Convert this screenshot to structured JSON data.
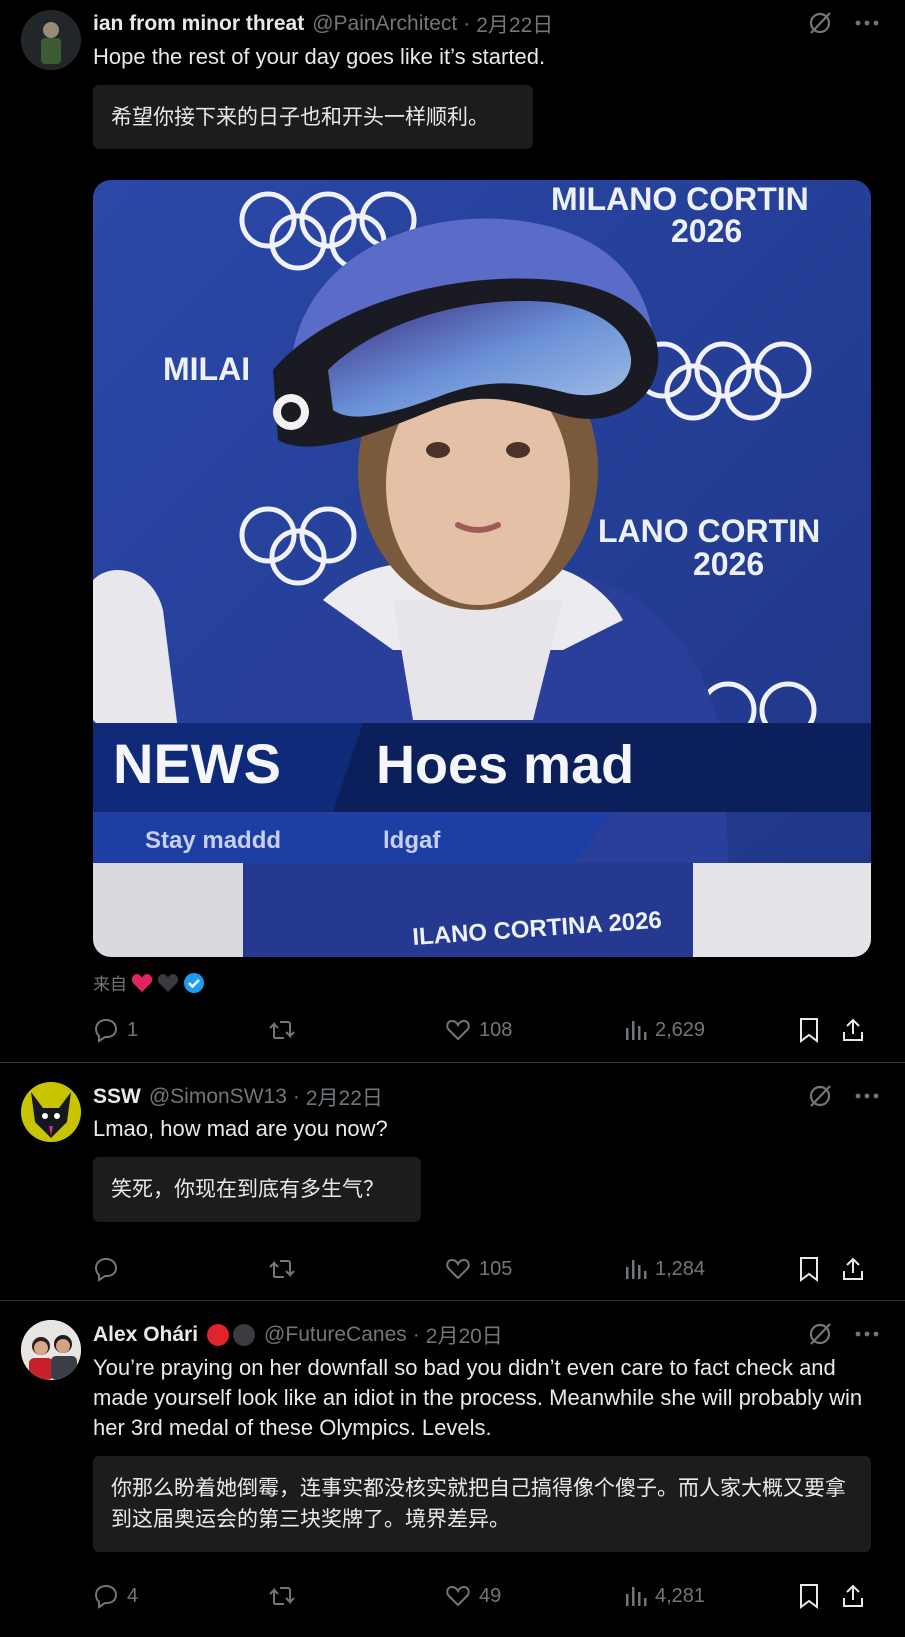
{
  "posts": [
    {
      "name": "ian from minor threat",
      "handle": "@PainArchitect",
      "date": "2月22日",
      "text": "Hope the rest of your day goes like it’s started.",
      "translation": "希望你接下来的日子也和开头一样顺利。",
      "media": {
        "logo_top": "MILANO CORTIN",
        "year_top": "2026",
        "logo_left": "MILAI",
        "logo_right": "LANO CORTIN",
        "year_right": "2026",
        "news_label": "NEWS",
        "headline": "Hoes mad",
        "ticker_left": "Stay maddd",
        "ticker_right": "ldgaf",
        "bottom_logo": "ILANO CORTINA 2026"
      },
      "from_label": "来自",
      "stats": {
        "replies": "1",
        "reposts": "",
        "likes": "108",
        "views": "2,629"
      }
    },
    {
      "name": "SSW",
      "handle": "@SimonSW13",
      "date": "2月22日",
      "text": "Lmao, how mad are you now?",
      "translation": "笑死，你现在到底有多生气？",
      "stats": {
        "replies": "",
        "reposts": "",
        "likes": "105",
        "views": "1,284"
      }
    },
    {
      "name": "Alex Ohári",
      "handle": "@FutureCanes",
      "date": "2月20日",
      "text": "You’re praying on her downfall so bad you didn’t even care to fact check and made yourself look like an idiot in the process. Meanwhile she will probably win her 3rd medal of these Olympics. Levels.",
      "translation": "你那么盼着她倒霉，连事实都没核实就把自己搞得像个傻子。而人家大概又要拿到这届奥运会的第三块奖牌了。境界差异。",
      "stats": {
        "replies": "4",
        "reposts": "",
        "likes": "49",
        "views": "4,281"
      }
    }
  ],
  "separator": "·",
  "colors": {
    "background": "#000000",
    "text": "#e7e9ea",
    "muted": "#71767b",
    "translation_bg": "#1c1c1c",
    "verified": "#1d9bf0",
    "heart_red": "#e0245e"
  },
  "icons": [
    "grok-icon",
    "more-icon",
    "reply-icon",
    "repost-icon",
    "like-icon",
    "views-icon",
    "bookmark-icon",
    "share-icon",
    "verified-icon"
  ]
}
